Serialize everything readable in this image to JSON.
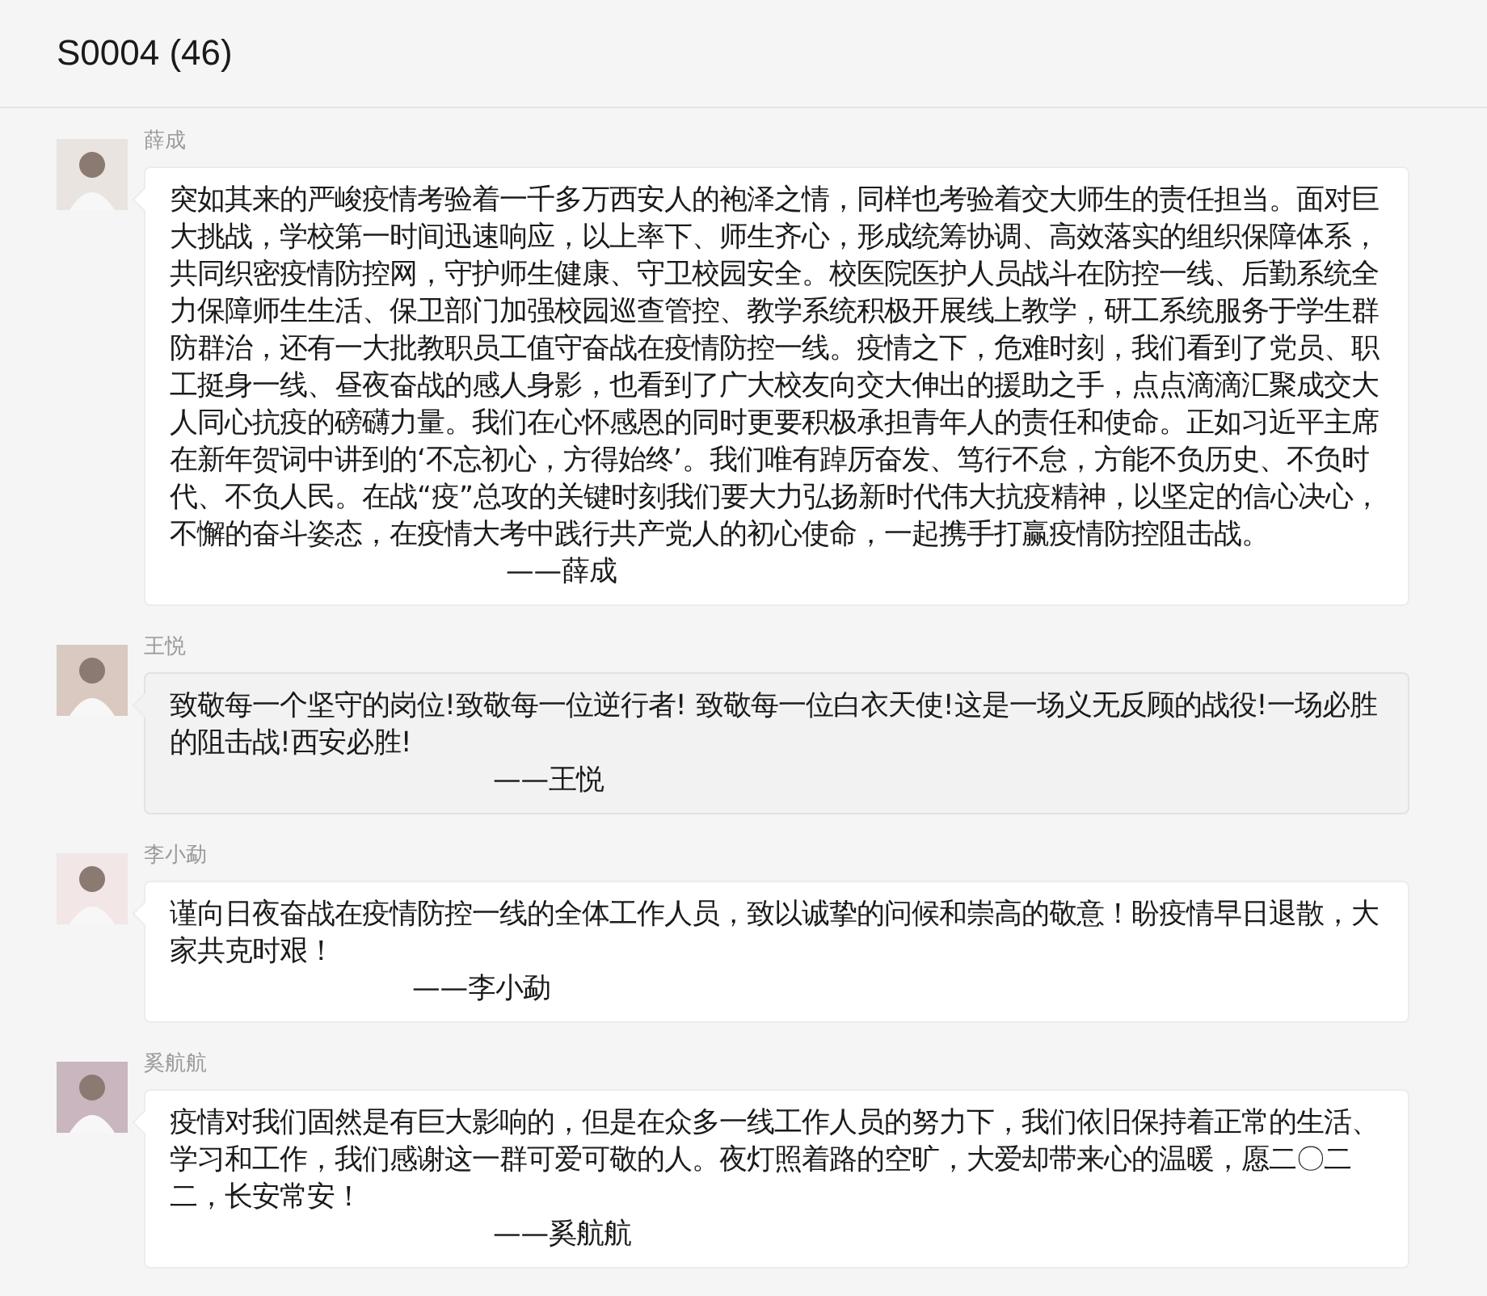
{
  "header": {
    "title": "S0004 (46)"
  },
  "messages": [
    {
      "sender": "薛成",
      "highlighted": false,
      "text": "突如其来的严峻疫情考验着一千多万西安人的袍泽之情，同样也考验着交大师生的责任担当。面对巨大挑战，学校第一时间迅速响应，以上率下、师生齐心，形成统筹协调、高效落实的组织保障体系，共同织密疫情防控网，守护师生健康、守卫校园安全。校医院医护人员战斗在防控一线、后勤系统全力保障师生生活、保卫部门加强校园巡查管控、教学系统积极开展线上教学，研工系统服务于学生群防群治，还有一大批教职员工值守奋战在疫情防控一线。疫情之下，危难时刻，我们看到了党员、职工挺身一线、昼夜奋战的感人身影，也看到了广大校友向交大伸出的援助之手，点点滴滴汇聚成交大人同心抗疫的磅礴力量。我们在心怀感恩的同时更要积极承担青年人的责任和使命。正如习近平主席在新年贺词中讲到的‘不忘初心，方得始终’。我们唯有踔厉奋发、笃行不怠，方能不负历史、不负时代、不负人民。在战“疫”总攻的关键时刻我们要大力弘扬新时代伟大抗疫精神，以坚定的信心决心，不懈的奋斗姿态，在疫情大考中践行共产党人的初心使命，一起携手打赢疫情防控阻击战。",
      "signature": "——薛成"
    },
    {
      "sender": "王悦",
      "highlighted": true,
      "text": "致敬每一个坚守的岗位!致敬每一位逆行者! 致敬每一位白衣天使!这是一场义无反顾的战役!一场必胜的阻击战!西安必胜!",
      "signature": "——王悦"
    },
    {
      "sender": "李小勐",
      "highlighted": false,
      "text": "谨向日夜奋战在疫情防控一线的全体工作人员，致以诚挚的问候和崇高的敬意！盼疫情早日退散，大家共克时艰！",
      "signature": "——李小勐"
    },
    {
      "sender": "奚航航",
      "highlighted": false,
      "text": "疫情对我们固然是有巨大影响的，但是在众多一线工作人员的努力下，我们依旧保持着正常的生活、学习和工作，我们感谢这一群可爱可敬的人。夜灯照着路的空旷，大爱却带来心的温暖，愿二〇二二，长安常安！",
      "signature": "——奚航航"
    }
  ]
}
